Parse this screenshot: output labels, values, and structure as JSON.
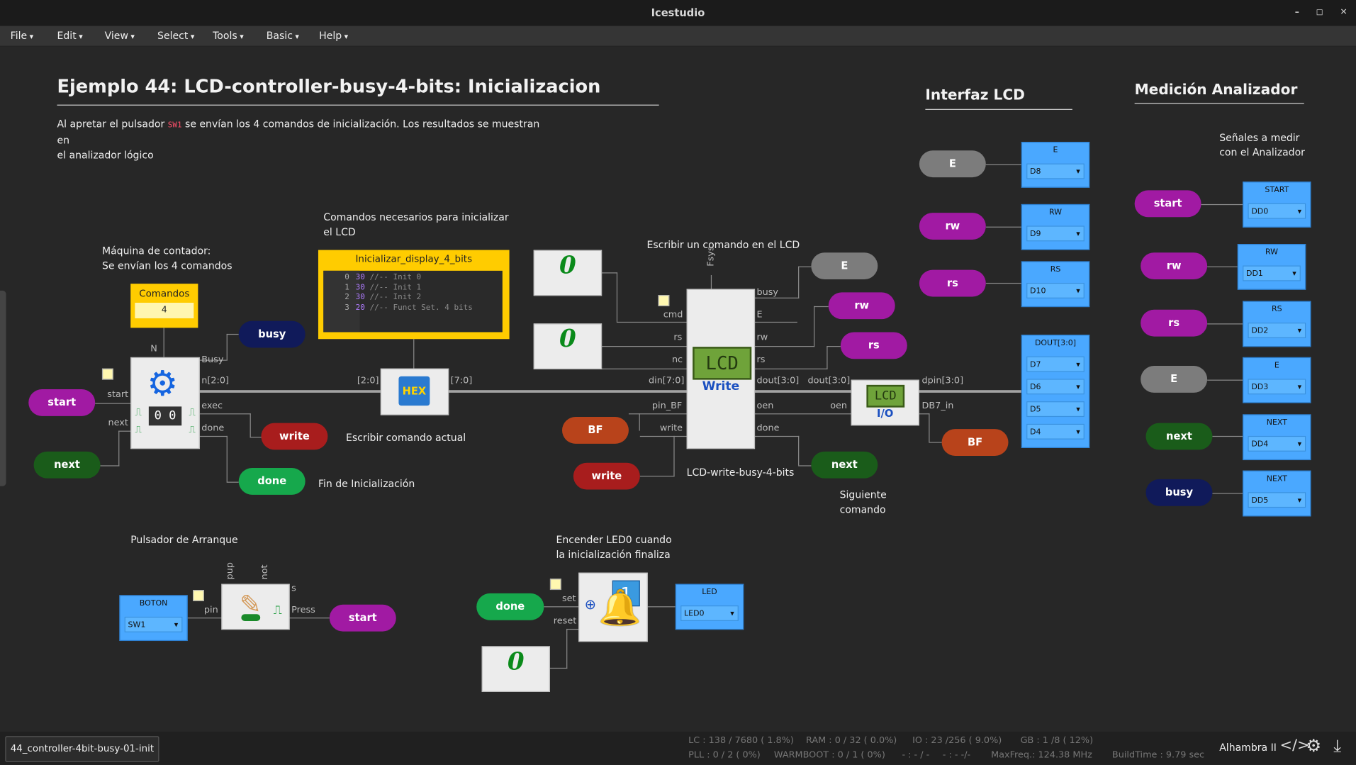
{
  "window": {
    "title": "Icestudio",
    "controls": [
      "–",
      "◻",
      "✕"
    ]
  },
  "menu": [
    "File",
    "Edit",
    "View",
    "Select",
    "Tools",
    "Basic",
    "Help"
  ],
  "title": "Ejemplo 44: LCD-controller-busy-4-bits: Inicializacion",
  "intro": {
    "part1": "Al apretar el pulsador ",
    "sw": "SW1",
    "part2": " se envían los 4 comandos de inicialización. Los resultados se muestran en",
    "line2": "el analizador lógico"
  },
  "section_lcd": "Interfaz LCD",
  "section_analyzer": "Medición Analizador",
  "notes": {
    "counter_1": "Máquina de contador:",
    "counter_2": "Se envían los 4 comandos",
    "cmds_1": "Comandos necesarios para inicializar",
    "cmds_2": "el LCD",
    "write_cmd": "Escribir un comando en el LCD",
    "current": "Escribir comando actual",
    "fin": "Fin de Inicialización",
    "next_1": "Siguiente",
    "next_2": "comando",
    "signals_1": "Señales a medir",
    "signals_2": "con el Analizador",
    "button": "Pulsador de Arranque",
    "led_1": "Encender LED0 cuando",
    "led_2": "la inicialización finaliza",
    "lcd_block": "LCD-write-busy-4-bits"
  },
  "comandos": {
    "label": "Comandos",
    "value": "4"
  },
  "memory": {
    "title": "Inicializar_display_4_bits",
    "lines": [
      {
        "n": "0",
        "v": "30",
        "c": "//-- Init 0"
      },
      {
        "n": "1",
        "v": "30",
        "c": "//-- Init 1"
      },
      {
        "n": "2",
        "v": "30",
        "c": "//-- Init 2"
      },
      {
        "n": "3",
        "v": "20",
        "c": "//-- Funct Set. 4 bits"
      }
    ]
  },
  "labels": {
    "start": "start",
    "next": "next",
    "busy": "busy",
    "write": "write",
    "done": "done",
    "E": "E",
    "rw": "rw",
    "rs": "rs",
    "BF": "BF",
    "Busy": "Busy",
    "n20": "n[2:0]",
    "exec": "exec",
    "bus20": "[2:0]",
    "bus70": "[7:0]",
    "cmd": "cmd",
    "nc": "nc",
    "din": "din[7:0]",
    "pinBF": "pin_BF",
    "fsys": "Fsys",
    "dout": "dout[3:0]",
    "oen": "oen",
    "dpin": "dpin[3:0]",
    "DB7": "DB7_in",
    "pin": "pin",
    "press": "Press",
    "pup": "pup",
    "not": "not",
    "s": "s",
    "set": "set",
    "reset": "reset",
    "N": "N",
    "hex": "HEX",
    "lcd": "LCD",
    "lcd_write": "Write",
    "lcd_io": "I/O",
    "one": "1",
    "zero": "0",
    "cnt": "0 0"
  },
  "lcd_pins": [
    {
      "name": "E",
      "value": "D8"
    },
    {
      "name": "RW",
      "value": "D9"
    },
    {
      "name": "RS",
      "value": "D10"
    }
  ],
  "dout": {
    "name": "DOUT[3:0]",
    "values": [
      "D7",
      "D6",
      "D5",
      "D4"
    ]
  },
  "analyzer_pins": [
    {
      "signal": "start",
      "name": "START",
      "value": "DD0"
    },
    {
      "signal": "rw",
      "name": "RW",
      "value": "DD1"
    },
    {
      "signal": "rs",
      "name": "RS",
      "value": "DD2"
    },
    {
      "signal": "E",
      "name": "E",
      "value": "DD3"
    },
    {
      "signal": "next",
      "name": "NEXT",
      "value": "DD4"
    },
    {
      "signal": "busy",
      "name": "NEXT",
      "value": "DD5"
    }
  ],
  "boton": {
    "name": "BOTON",
    "value": "SW1"
  },
  "led": {
    "name": "LED",
    "value": "LED0"
  },
  "status": {
    "tab": "44_controller-4bit-busy-01-init",
    "lc": "LC : 138 / 7680 ( 1.8%)",
    "ram": "RAM : 0 / 32 ( 0.0%)",
    "io": "IO : 23 /256 ( 9.0%)",
    "gb": "GB : 1 /8 ( 12%)",
    "pll": "PLL : 0 / 2 ( 0%)",
    "warmboot": "WARMBOOT : 0 / 1 ( 0%)",
    "dash1": "- : - / -",
    "dash2": "- : - -/-",
    "maxfreq": "MaxFreq.: 124.38 MHz",
    "buildtime": "BuildTime : 9.79 sec",
    "board": "Alhambra II"
  },
  "colors": {
    "pin_blue": "#4aa8ff",
    "port_purple": "#a11aa3",
    "memory_yellow": "#ffcc00"
  }
}
